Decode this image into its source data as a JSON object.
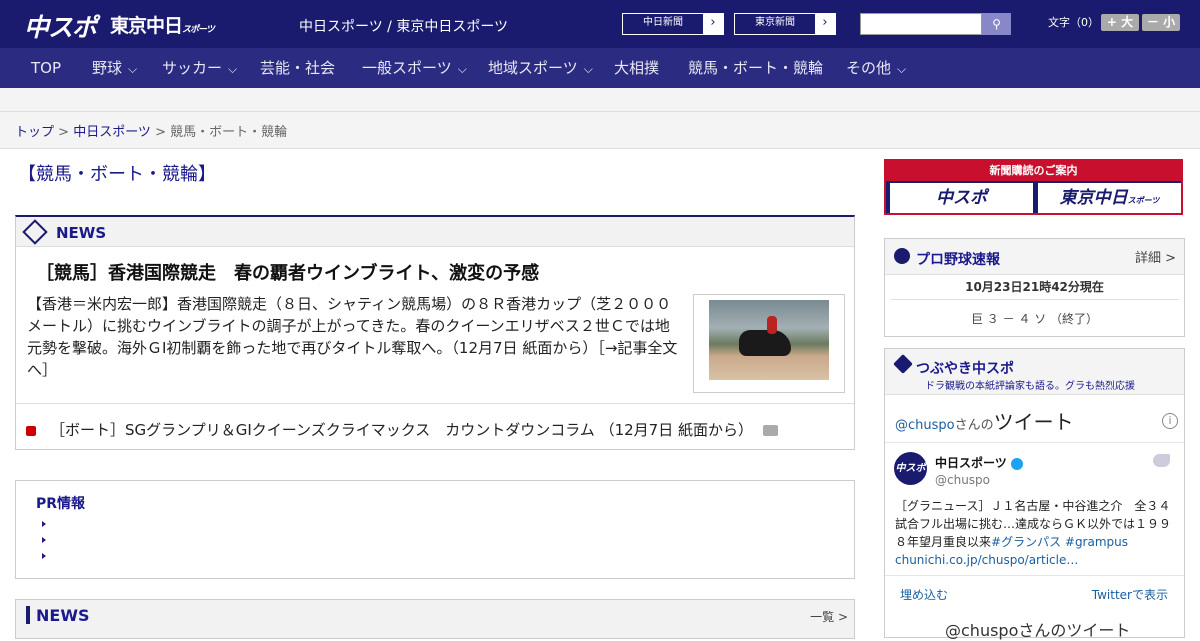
{
  "header": {
    "logo_chunichi": "中スポ",
    "logo_tokyo": "東京中日",
    "logo_tokyo_small": "スポーツ",
    "site_name": "中日スポーツ / 東京中日スポーツ",
    "paper_buttons": [
      "中日新聞",
      "東京新聞"
    ],
    "font_size_label": "文字（0）",
    "font_bigger": "+ 大",
    "font_smaller": "－ 小",
    "search_placeholder": ""
  },
  "nav": [
    "TOP",
    "野球",
    "サッカー",
    "芸能・社会",
    "一般スポーツ",
    "地域スポーツ",
    "大相撲",
    "競馬・ボート・競輪",
    "その他"
  ],
  "breadcrumb": {
    "home": "トップ",
    "section": "中日スポーツ",
    "current": "競馬・ボート・競輪",
    "sep": " > "
  },
  "page_title": "【競馬・ボート・競輪】",
  "news": {
    "label": "NEWS",
    "headline": "［競馬］香港国際競走　春の覇者ウインブライト、激変の予感",
    "body": "【香港＝米内宏一郎】香港国際競走（８日、シャティン競馬場）の８Ｒ香港カップ（芝２０００メートル）に挑むウインブライトの調子が上がってきた。春のクイーンエリザベス２世Ｃでは地元勢を撃破。海外ＧⅠ初制覇を飾った地で再びタイトル奪取へ。（12月7日 紙面から）［→記事全文へ］",
    "sub_link": "［ボート］SGグランプリ＆GIクイーンズクライマックス　カウントダウンコラム （12月7日 紙面から）"
  },
  "pr": {
    "label": "PR情報"
  },
  "news2": {
    "label": "NEWS",
    "more": "一覧 >"
  },
  "subscribe": {
    "label": "新聞購読のご案内",
    "b1": "中スポ",
    "b2": "東京中日",
    "b2_small": "スポーツ"
  },
  "baseball": {
    "title": "プロ野球速報",
    "detail": "詳細 >",
    "time": "10月23日21時42分現在",
    "score": "巨 ３ － ４ ソ （終了）"
  },
  "tsubuyaki": {
    "title": "つぶやき中スポ",
    "sub": "ドラ観戦の本紙評論家も語る。グラも熱烈応援",
    "handle_prefix": "@chuspo",
    "handle_suffix": "さんの",
    "heading": "ツイート",
    "info": "i",
    "account_name": "中日スポーツ",
    "account_handle": "@chuspo",
    "avatar_text": "中スポ",
    "tweet_text": "［グラニュース］Ｊ１名古屋・中谷進之介　全３４試合フル出場に挑む…達成ならＧＫ以外では１９９８年望月重良以来",
    "tweet_tag": "#グランパス #grampus",
    "tweet_link": "chunichi.co.jp/chuspo/article…",
    "embed": "埋め込む",
    "view": "Twitterで表示",
    "footer": "@chuspoさんのツイート"
  }
}
